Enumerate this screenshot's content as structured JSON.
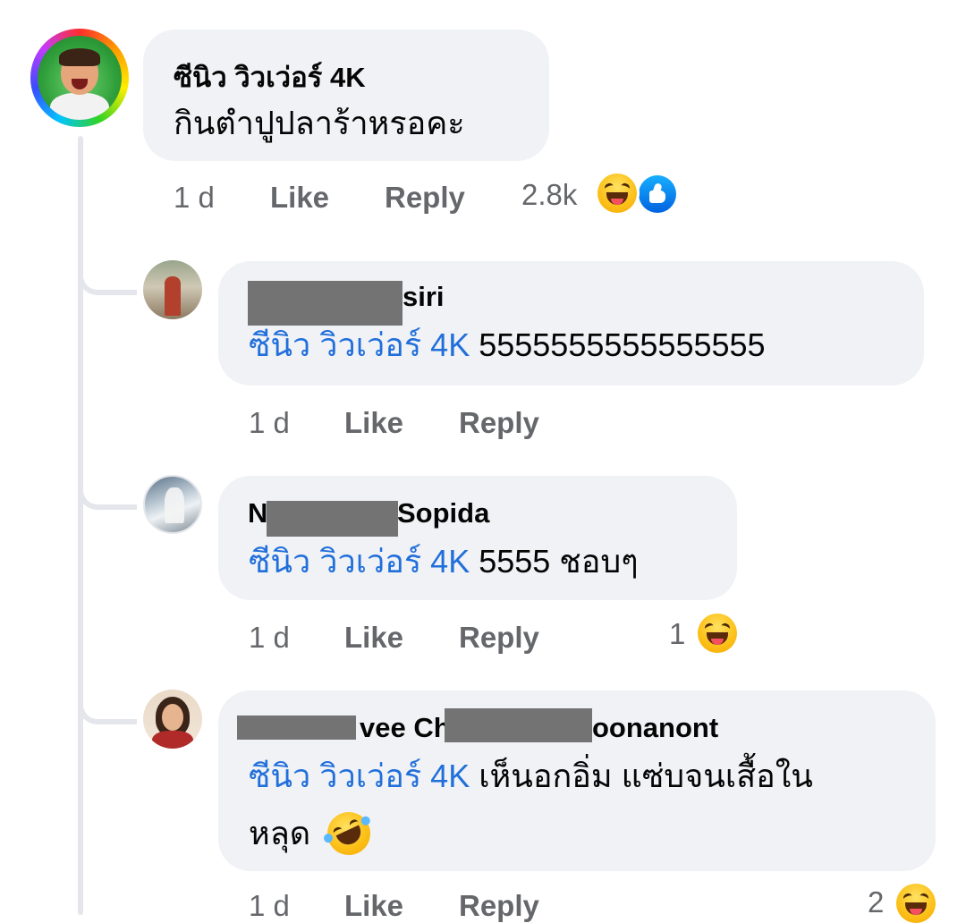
{
  "main_comment": {
    "author": "ซีนิว วิวเว่อร์ 4K",
    "text": "กินตำปูปลาร้าหรอคะ",
    "time": "1 d",
    "like_label": "Like",
    "reply_label": "Reply",
    "reaction_count": "2.8k",
    "reactions": [
      "haha-icon",
      "like-icon"
    ]
  },
  "replies": [
    {
      "author_visible": "siri",
      "mention": "ซีนิว วิวเว่อร์ 4K",
      "text": "5555555555555555",
      "time": "1 d",
      "like_label": "Like",
      "reply_label": "Reply"
    },
    {
      "author_prefix": "N",
      "author_visible": "Sopida",
      "mention": "ซีนิว วิวเว่อร์ 4K",
      "text": "5555 ชอบๆ",
      "time": "1 d",
      "like_label": "Like",
      "reply_label": "Reply",
      "reaction_count": "1",
      "reactions": [
        "haha-icon"
      ]
    },
    {
      "author_mid": "vee Ch",
      "author_visible": "oonanont",
      "mention": "ซีนิว วิวเว่อร์ 4K",
      "text_line1": "เห็นอกอิ่ม แซ่บจนเสื้อใน",
      "text_line2": "หลุด",
      "emoji": "rofl-icon",
      "time": "1 d",
      "like_label": "Like",
      "reply_label": "Reply",
      "reaction_count": "2",
      "reactions": [
        "haha-icon"
      ]
    }
  ],
  "colors": {
    "bubble": "#f0f2f5",
    "mention": "#216fdb",
    "meta": "#65676b",
    "thread_line": "#e4e6eb",
    "redaction": "#737373"
  }
}
